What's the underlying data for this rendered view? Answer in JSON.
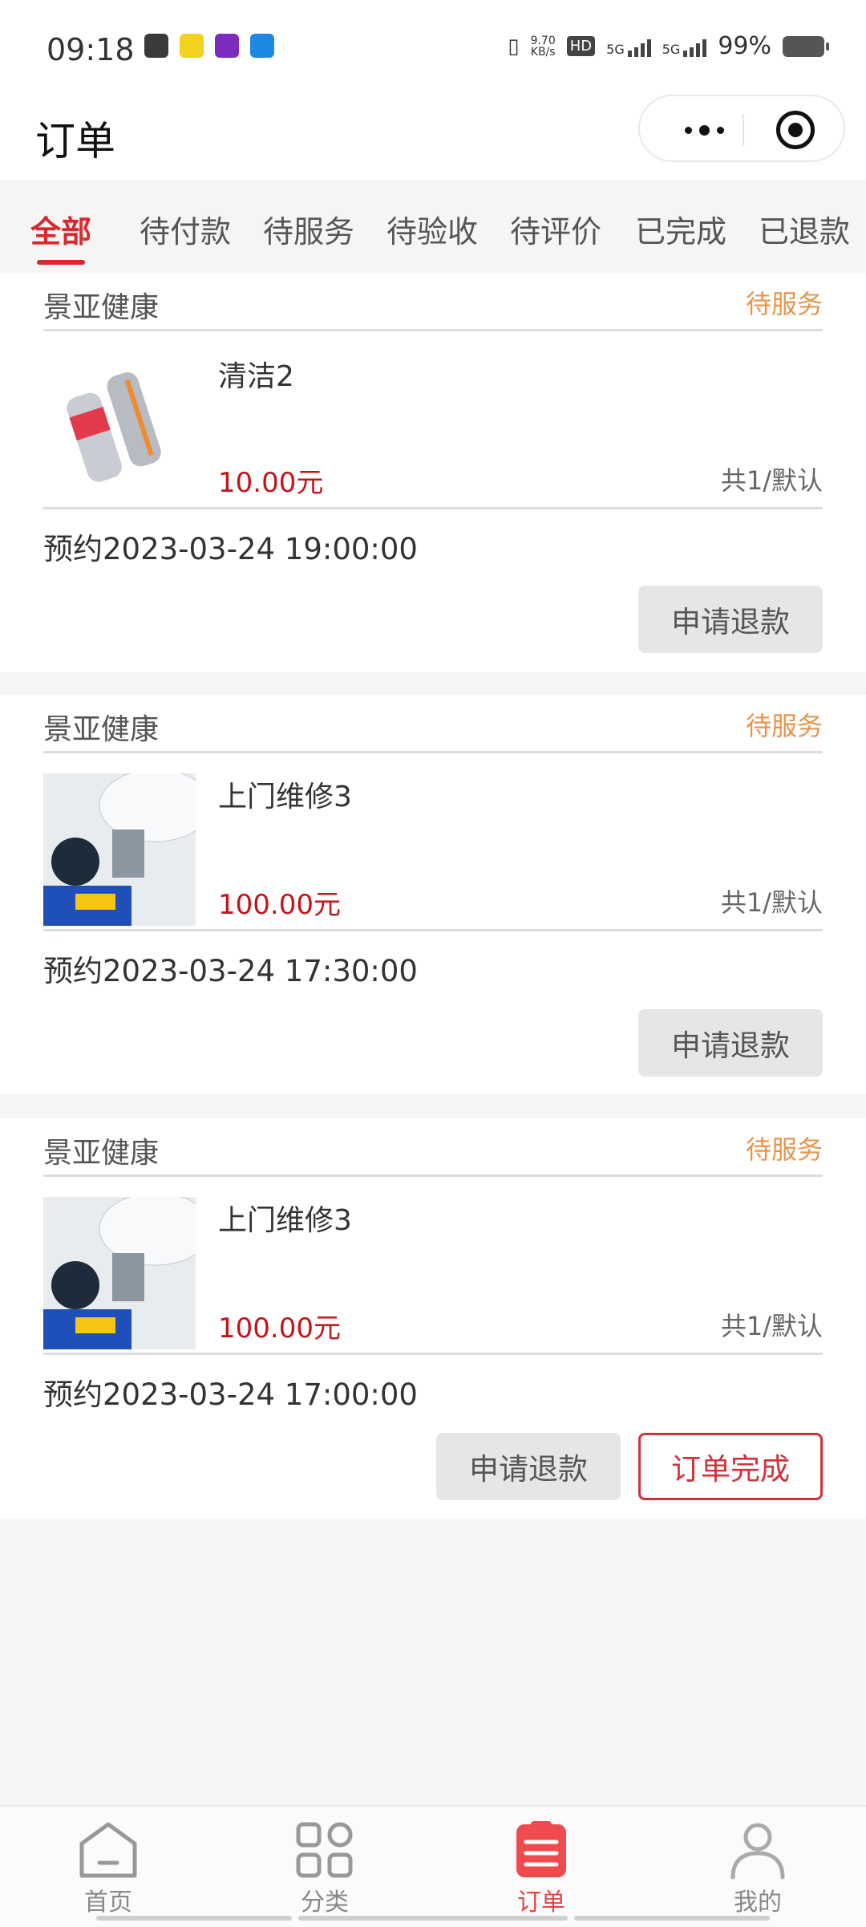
{
  "statusbar": {
    "time": "09:18",
    "net_speed_top": "9.70",
    "net_speed_bottom": "KB/s",
    "sim1": "HD",
    "sig1": "5G",
    "sig2": "5G",
    "battery": "99%"
  },
  "header": {
    "title": "订单"
  },
  "tabs": [
    {
      "label": "全部",
      "active": true
    },
    {
      "label": "待付款"
    },
    {
      "label": "待服务"
    },
    {
      "label": "待验收"
    },
    {
      "label": "待评价"
    },
    {
      "label": "已完成"
    },
    {
      "label": "已退款"
    }
  ],
  "orders": [
    {
      "shop": "景亚健康",
      "status": "待服务",
      "item_name": "清洁2",
      "price": "10.00元",
      "qty": "共1/默认",
      "appointment": "预约2023-03-24 19:00:00",
      "buttons": [
        "申请退款"
      ]
    },
    {
      "shop": "景亚健康",
      "status": "待服务",
      "item_name": "上门维修3",
      "price": "100.00元",
      "qty": "共1/默认",
      "appointment": "预约2023-03-24 17:30:00",
      "buttons": [
        "申请退款"
      ]
    },
    {
      "shop": "景亚健康",
      "status": "待服务",
      "item_name": "上门维修3",
      "price": "100.00元",
      "qty": "共1/默认",
      "appointment": "预约2023-03-24 17:00:00",
      "buttons": [
        "申请退款",
        "订单完成"
      ]
    }
  ],
  "tabbar": [
    {
      "label": "首页",
      "icon": "home-icon"
    },
    {
      "label": "分类",
      "icon": "category-icon"
    },
    {
      "label": "订单",
      "icon": "order-list-icon",
      "active": true
    },
    {
      "label": "我的",
      "icon": "user-icon"
    }
  ],
  "colors": {
    "accent": "#d9282f",
    "status_orange": "#e8944a",
    "price_red": "#c4141b"
  }
}
